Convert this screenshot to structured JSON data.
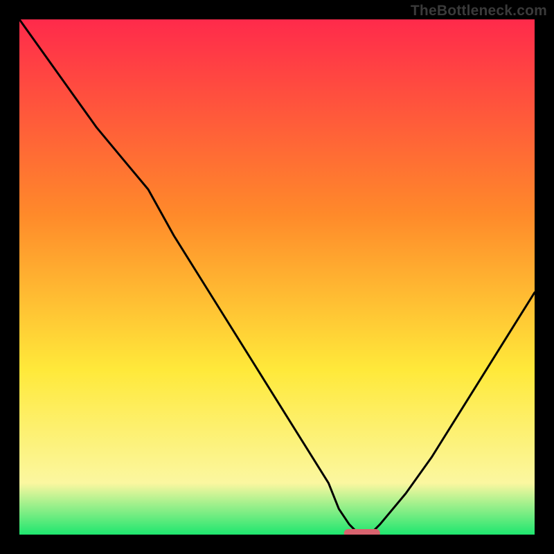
{
  "watermark": "TheBottleneck.com",
  "colors": {
    "red": "#ff2a4b",
    "orange": "#ff8a2a",
    "yellow": "#ffe93a",
    "paleyellow": "#fbf7a0",
    "green": "#1ee66f",
    "curve": "#000000",
    "marker": "#d9636f"
  },
  "chart_data": {
    "type": "line",
    "title": "",
    "xlabel": "",
    "ylabel": "",
    "xlim": [
      0,
      100
    ],
    "ylim": [
      0,
      100
    ],
    "x": [
      0,
      5,
      10,
      15,
      20,
      25,
      30,
      35,
      40,
      45,
      50,
      55,
      60,
      62,
      64,
      66,
      68,
      70,
      75,
      80,
      85,
      90,
      95,
      100
    ],
    "y": [
      100,
      93,
      86,
      79,
      73,
      67,
      58,
      50,
      42,
      34,
      26,
      18,
      10,
      5,
      2,
      0,
      0,
      2,
      8,
      15,
      23,
      31,
      39,
      47
    ],
    "marker": {
      "x_start": 63,
      "x_end": 70,
      "y": 0
    },
    "gradient_stops": [
      {
        "pct": 0,
        "color_key": "red"
      },
      {
        "pct": 38,
        "color_key": "orange"
      },
      {
        "pct": 68,
        "color_key": "yellow"
      },
      {
        "pct": 90,
        "color_key": "paleyellow"
      },
      {
        "pct": 100,
        "color_key": "green"
      }
    ]
  }
}
